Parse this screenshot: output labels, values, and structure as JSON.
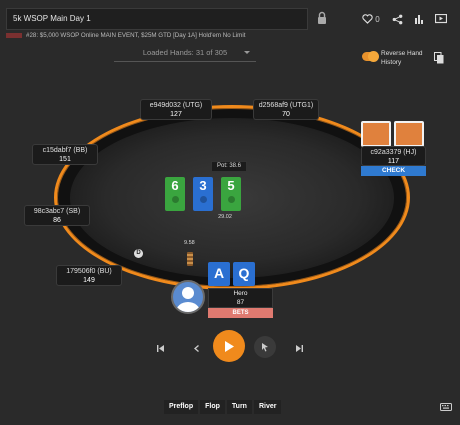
{
  "header": {
    "title": "5k WSOP Main Day 1",
    "heart_count": "0",
    "subtitle": "#28: $5,000 WSOP Online MAIN EVENT, $25M GTD [Day 1A] Hold'em No Limit"
  },
  "loaded_hands": "Loaded Hands: 31 of 305",
  "toggle": {
    "label": "Reverse Hand History",
    "on": true
  },
  "seats": {
    "utg": {
      "name": "e949d032 (UTG)",
      "stack": "127"
    },
    "utg1": {
      "name": "d2568af9 (UTG1)",
      "stack": "70"
    },
    "bb": {
      "name": "c15dabf7 (BB)",
      "stack": "151"
    },
    "sb": {
      "name": "98c3abc7 (SB)",
      "stack": "86"
    },
    "bu": {
      "name": "179506f0 (BU)",
      "stack": "149"
    },
    "hj": {
      "name": "c92a3379 (HJ)",
      "stack": "117",
      "action": "CHECK"
    },
    "hero": {
      "name": "Hero",
      "stack": "87",
      "action": "BETS",
      "bet": "9.58"
    }
  },
  "pot": "Pot: 38.6",
  "board": {
    "cards": [
      {
        "rank": "6",
        "suit": "clubs",
        "color": "#3aa53f"
      },
      {
        "rank": "3",
        "suit": "spades",
        "color": "#2a6fd1"
      },
      {
        "rank": "5",
        "suit": "clubs",
        "color": "#3aa53f"
      }
    ],
    "value": "29.02"
  },
  "hero_cards": [
    {
      "rank": "A",
      "suit": "spades",
      "color": "#2a6fd1"
    },
    {
      "rank": "Q",
      "suit": "spades",
      "color": "#2a6fd1"
    }
  ],
  "dealer_button": "D",
  "streets": [
    "Preflop",
    "Flop",
    "Turn",
    "River"
  ],
  "colors": {
    "accent": "#f08a1c",
    "check": "#2f7ad0",
    "bets": "#e07a70"
  }
}
